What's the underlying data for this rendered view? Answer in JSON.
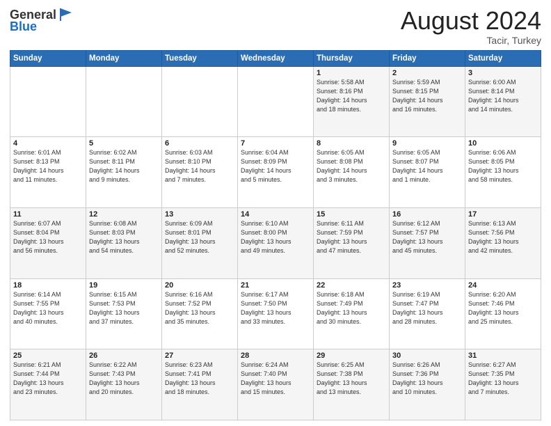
{
  "header": {
    "logo_general": "General",
    "logo_blue": "Blue",
    "month_title": "August 2024",
    "location": "Tacir, Turkey"
  },
  "days_of_week": [
    "Sunday",
    "Monday",
    "Tuesday",
    "Wednesday",
    "Thursday",
    "Friday",
    "Saturday"
  ],
  "weeks": [
    [
      {
        "day": "",
        "info": ""
      },
      {
        "day": "",
        "info": ""
      },
      {
        "day": "",
        "info": ""
      },
      {
        "day": "",
        "info": ""
      },
      {
        "day": "1",
        "info": "Sunrise: 5:58 AM\nSunset: 8:16 PM\nDaylight: 14 hours\nand 18 minutes."
      },
      {
        "day": "2",
        "info": "Sunrise: 5:59 AM\nSunset: 8:15 PM\nDaylight: 14 hours\nand 16 minutes."
      },
      {
        "day": "3",
        "info": "Sunrise: 6:00 AM\nSunset: 8:14 PM\nDaylight: 14 hours\nand 14 minutes."
      }
    ],
    [
      {
        "day": "4",
        "info": "Sunrise: 6:01 AM\nSunset: 8:13 PM\nDaylight: 14 hours\nand 11 minutes."
      },
      {
        "day": "5",
        "info": "Sunrise: 6:02 AM\nSunset: 8:11 PM\nDaylight: 14 hours\nand 9 minutes."
      },
      {
        "day": "6",
        "info": "Sunrise: 6:03 AM\nSunset: 8:10 PM\nDaylight: 14 hours\nand 7 minutes."
      },
      {
        "day": "7",
        "info": "Sunrise: 6:04 AM\nSunset: 8:09 PM\nDaylight: 14 hours\nand 5 minutes."
      },
      {
        "day": "8",
        "info": "Sunrise: 6:05 AM\nSunset: 8:08 PM\nDaylight: 14 hours\nand 3 minutes."
      },
      {
        "day": "9",
        "info": "Sunrise: 6:05 AM\nSunset: 8:07 PM\nDaylight: 14 hours\nand 1 minute."
      },
      {
        "day": "10",
        "info": "Sunrise: 6:06 AM\nSunset: 8:05 PM\nDaylight: 13 hours\nand 58 minutes."
      }
    ],
    [
      {
        "day": "11",
        "info": "Sunrise: 6:07 AM\nSunset: 8:04 PM\nDaylight: 13 hours\nand 56 minutes."
      },
      {
        "day": "12",
        "info": "Sunrise: 6:08 AM\nSunset: 8:03 PM\nDaylight: 13 hours\nand 54 minutes."
      },
      {
        "day": "13",
        "info": "Sunrise: 6:09 AM\nSunset: 8:01 PM\nDaylight: 13 hours\nand 52 minutes."
      },
      {
        "day": "14",
        "info": "Sunrise: 6:10 AM\nSunset: 8:00 PM\nDaylight: 13 hours\nand 49 minutes."
      },
      {
        "day": "15",
        "info": "Sunrise: 6:11 AM\nSunset: 7:59 PM\nDaylight: 13 hours\nand 47 minutes."
      },
      {
        "day": "16",
        "info": "Sunrise: 6:12 AM\nSunset: 7:57 PM\nDaylight: 13 hours\nand 45 minutes."
      },
      {
        "day": "17",
        "info": "Sunrise: 6:13 AM\nSunset: 7:56 PM\nDaylight: 13 hours\nand 42 minutes."
      }
    ],
    [
      {
        "day": "18",
        "info": "Sunrise: 6:14 AM\nSunset: 7:55 PM\nDaylight: 13 hours\nand 40 minutes."
      },
      {
        "day": "19",
        "info": "Sunrise: 6:15 AM\nSunset: 7:53 PM\nDaylight: 13 hours\nand 37 minutes."
      },
      {
        "day": "20",
        "info": "Sunrise: 6:16 AM\nSunset: 7:52 PM\nDaylight: 13 hours\nand 35 minutes."
      },
      {
        "day": "21",
        "info": "Sunrise: 6:17 AM\nSunset: 7:50 PM\nDaylight: 13 hours\nand 33 minutes."
      },
      {
        "day": "22",
        "info": "Sunrise: 6:18 AM\nSunset: 7:49 PM\nDaylight: 13 hours\nand 30 minutes."
      },
      {
        "day": "23",
        "info": "Sunrise: 6:19 AM\nSunset: 7:47 PM\nDaylight: 13 hours\nand 28 minutes."
      },
      {
        "day": "24",
        "info": "Sunrise: 6:20 AM\nSunset: 7:46 PM\nDaylight: 13 hours\nand 25 minutes."
      }
    ],
    [
      {
        "day": "25",
        "info": "Sunrise: 6:21 AM\nSunset: 7:44 PM\nDaylight: 13 hours\nand 23 minutes."
      },
      {
        "day": "26",
        "info": "Sunrise: 6:22 AM\nSunset: 7:43 PM\nDaylight: 13 hours\nand 20 minutes."
      },
      {
        "day": "27",
        "info": "Sunrise: 6:23 AM\nSunset: 7:41 PM\nDaylight: 13 hours\nand 18 minutes."
      },
      {
        "day": "28",
        "info": "Sunrise: 6:24 AM\nSunset: 7:40 PM\nDaylight: 13 hours\nand 15 minutes."
      },
      {
        "day": "29",
        "info": "Sunrise: 6:25 AM\nSunset: 7:38 PM\nDaylight: 13 hours\nand 13 minutes."
      },
      {
        "day": "30",
        "info": "Sunrise: 6:26 AM\nSunset: 7:36 PM\nDaylight: 13 hours\nand 10 minutes."
      },
      {
        "day": "31",
        "info": "Sunrise: 6:27 AM\nSunset: 7:35 PM\nDaylight: 13 hours\nand 7 minutes."
      }
    ]
  ]
}
